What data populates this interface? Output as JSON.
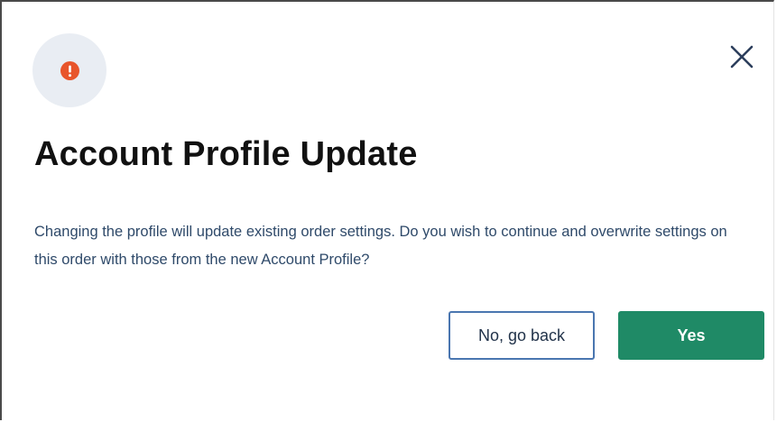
{
  "dialog": {
    "title": "Account Profile Update",
    "message": "Changing the profile will update existing order settings. Do you wish to continue and overwrite settings on this order with those from the new Account Profile?",
    "icons": {
      "status": "alert-icon",
      "close": "close-icon"
    },
    "buttons": {
      "cancel_label": "No, go back",
      "confirm_label": "Yes"
    },
    "colors": {
      "alert": "#e8552b",
      "alert_badge_bg": "#e9edf3",
      "primary": "#1f8a66",
      "secondary_border": "#4a76b0",
      "message_text": "#2f4a6a"
    }
  }
}
